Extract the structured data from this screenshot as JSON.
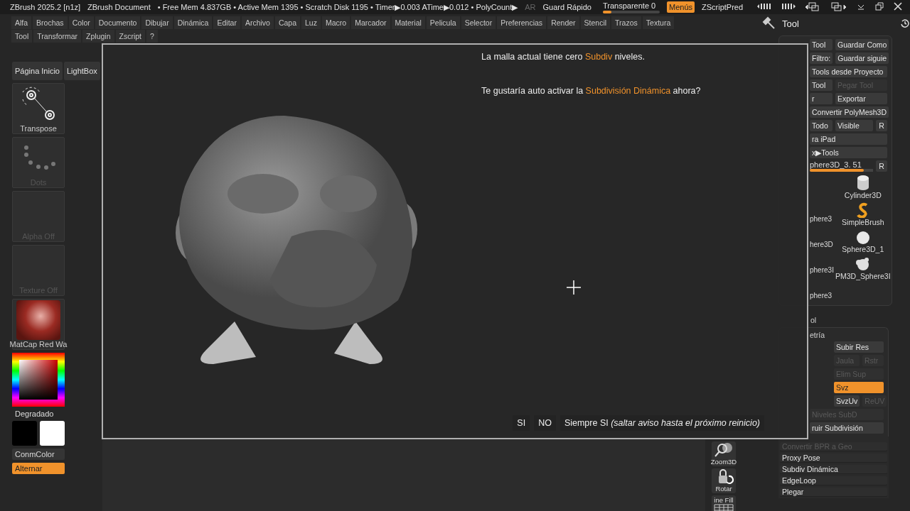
{
  "title_bar": {
    "app": "ZBrush 2025.2 [n1z]",
    "document": "ZBrush Document",
    "stats": "• Free Mem 4.837GB • Active Mem 1395 • Scratch Disk 1195 • Timer▶0.003 ATime▶0.012 • PolyCount▶",
    "ar": "AR",
    "quick_save": "Guard Rápido",
    "transparency": {
      "label": "Transparente 0",
      "level": 0.15
    },
    "menus_button": {
      "label": "Menús",
      "on": true
    },
    "zscript": "ZScriptPred"
  },
  "menu_rows": [
    [
      "Alfa",
      "Brochas",
      "Color",
      "Documento",
      "Dibujar",
      "Dinámica",
      "Editar",
      "Archivo",
      "Capa",
      "Luz",
      "Macro",
      "Marcador",
      "Material",
      "Pelicula",
      "Selector",
      "Preferencias",
      "Render",
      "Stencil",
      "Trazos",
      "Textura"
    ],
    [
      "Tool",
      "Transformar",
      "Zplugin",
      "Zscript",
      "?"
    ]
  ],
  "left_panel": {
    "buttons": [
      "Página Inicio",
      "LightBox"
    ],
    "tiles": [
      {
        "kind": "transpose",
        "label": "Transpose",
        "disabled": false
      },
      {
        "kind": "dots",
        "label": "Dots",
        "disabled": true
      },
      {
        "kind": "blank",
        "label": "Alpha Off",
        "disabled": true
      },
      {
        "kind": "blank",
        "label": "Texture Off",
        "disabled": true
      },
      {
        "kind": "matcap",
        "label": "MatCap Red Wa",
        "disabled": false
      }
    ],
    "gradient": "Degradado",
    "color_mode": "ConmColor",
    "alternate": {
      "label": "Alternar",
      "on": true
    }
  },
  "dialog": {
    "lines": [
      "La malla actual tiene cero **Subdiv** niveles.",
      "Te gustaría auto activar la **Subdivisión Dinámica** ahora?"
    ],
    "buttons": [
      "SI",
      "NO",
      "Siempre SI *(saltar aviso hasta el próximo reinicio)*"
    ]
  },
  "view_tools": [
    {
      "kind": "zoom",
      "label": "Zoom3D"
    },
    {
      "kind": "rotate",
      "label": "Rotar"
    },
    {
      "kind": "grid",
      "label": "ine Fill"
    }
  ],
  "tool_panel": {
    "title": "Tool",
    "rows": [
      [
        {
          "label": "Tool",
          "disabled": false
        },
        {
          "label": "Guardar Como",
          "disabled": false
        }
      ],
      [
        {
          "label": "Filtro:",
          "disabled": false
        },
        {
          "label": "Guardar siguie",
          "disabled": false
        }
      ],
      [
        {
          "label": "Tools desde Proyecto",
          "disabled": false
        }
      ],
      [
        {
          "label": "Tool",
          "disabled": false
        },
        {
          "label": "Pegar Tool",
          "disabled": true
        }
      ],
      [
        {
          "label": "r",
          "disabled": false
        },
        {
          "label": "Exportar",
          "disabled": false
        }
      ],
      [
        {
          "label": "Convertir PolyMesh3D",
          "disabled": false
        }
      ],
      [
        {
          "label": "Todo",
          "disabled": false
        },
        {
          "label": "Visible",
          "disabled": false
        },
        {
          "label": "R",
          "disabled": false
        }
      ],
      [
        {
          "label": "ra iPad",
          "disabled": false
        }
      ],
      [
        {
          "label": "x▶Tools",
          "disabled": false
        }
      ]
    ],
    "slider": {
      "label": "phere3D_3. 51",
      "level": 0.85,
      "reset": "R"
    },
    "thumbs_left": [
      "phere3",
      "here3D",
      "phere3I",
      "phere3"
    ],
    "thumbs_right": [
      {
        "kind": "cylinder",
        "label": "Cylinder3D"
      },
      {
        "kind": "brush",
        "label": "SimpleBrush"
      },
      {
        "kind": "sphere",
        "label": "Sphere3D_1"
      },
      {
        "kind": "lumpy",
        "label": "PM3D_Sphere3I"
      }
    ],
    "subtool_header": "ol",
    "geometry_header": "etría",
    "geometry_rows": [
      {
        "kind": "right",
        "cells": [
          {
            "label": "Subir Res",
            "disabled": false,
            "on": false
          }
        ]
      },
      {
        "kind": "right",
        "cells": [
          {
            "label": "Jaula",
            "disabled": true,
            "on": false
          },
          {
            "label": "Rstr",
            "disabled": true,
            "on": false
          }
        ]
      },
      {
        "kind": "right",
        "cells": [
          {
            "label": "Elim Sup",
            "disabled": true,
            "on": false
          }
        ]
      },
      {
        "kind": "right",
        "cells": [
          {
            "label": "Svz",
            "disabled": false,
            "on": true
          }
        ]
      },
      {
        "kind": "right",
        "cells": [
          {
            "label": "SvzUv",
            "disabled": false,
            "on": false
          },
          {
            "label": "ReUV",
            "disabled": true,
            "on": false
          }
        ]
      },
      {
        "kind": "full",
        "cells": [
          {
            "label": "Niveles SubD",
            "disabled": true,
            "on": false
          }
        ]
      },
      {
        "kind": "full",
        "cells": [
          {
            "label": "ruir Subdivisión",
            "disabled": false,
            "on": false
          }
        ]
      }
    ],
    "actions": [
      {
        "label": "Convertir BPR a Geo",
        "disabled": true
      },
      {
        "label": "Proxy Pose",
        "disabled": false
      },
      {
        "label": "Subdiv Dinámica",
        "disabled": false
      },
      {
        "label": "EdgeLoop",
        "disabled": false
      },
      {
        "label": "Plegar",
        "disabled": false
      }
    ]
  }
}
